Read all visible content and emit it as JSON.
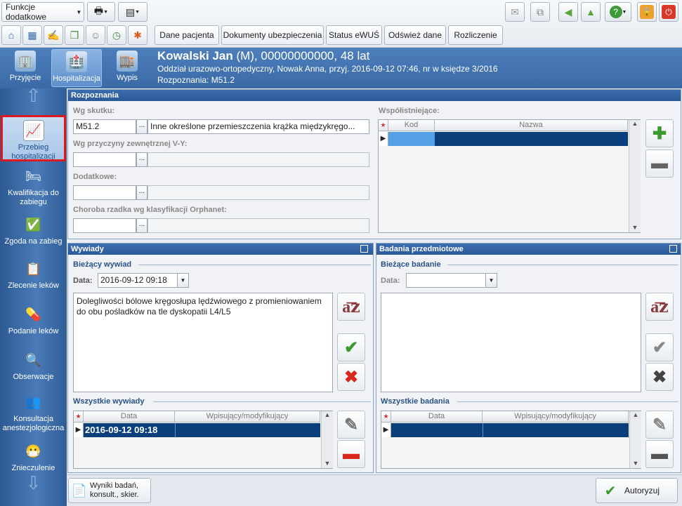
{
  "toolbar": {
    "funkcje_label": "Funkcje dodatkowe",
    "tabs": [
      "Dane pacjenta",
      "Dokumenty ubezpieczenia",
      "Status eWUŚ",
      "Odśwież dane",
      "Rozliczenie"
    ]
  },
  "nav": {
    "top": [
      {
        "label": "Przyjęcie"
      },
      {
        "label": "Hospitalizacja"
      },
      {
        "label": "Wypis"
      }
    ],
    "side": [
      {
        "label": "Przebieg hospitalizacji"
      },
      {
        "label": "Kwalifikacja do zabiegu"
      },
      {
        "label": "Zgoda na zabieg"
      },
      {
        "label": "Zlecenie leków"
      },
      {
        "label": "Podanie leków"
      },
      {
        "label": "Obserwacje"
      },
      {
        "label": "Konsultacja anestezjologiczna"
      },
      {
        "label": "Znieczulenie"
      }
    ]
  },
  "patient": {
    "name": "Kowalski Jan",
    "details": " (M), 00000000000, 48 lat",
    "line2": "Oddział urazowo-ortopedyczny, Nowak Anna, przyj. 2016-09-12 07:46, nr w księdze 3/2016",
    "line3": "Rozpoznania: M51.2"
  },
  "rozpoznania": {
    "title": "Rozpoznania",
    "wg_skutku_label": "Wg skutku:",
    "wg_skutku_code": "M51.2",
    "wg_skutku_name": "Inne określone przemieszczenia krążka międzykręgo...",
    "wg_przyczyny_label": "Wg przyczyny zewnętrznej V-Y:",
    "dodatkowe_label": "Dodatkowe:",
    "orphanet_label": "Choroba rzadka wg klasyfikacji Orphanet:",
    "wspol_label": "Współistniejące:",
    "wspol_cols": [
      "Kod",
      "Nazwa"
    ]
  },
  "wywiady": {
    "title": "Wywiady",
    "current_label": "Bieżący wywiad",
    "data_label": "Data:",
    "data_value": "2016-09-12 09:18",
    "text": "Dolegliwości bólowe kręgosłupa lędźwiowego z promieniowaniem do obu pośladków na tle dyskopatii L4/L5",
    "all_label": "Wszystkie wywiady",
    "cols": [
      "Data",
      "Wpisujący/modyfikujący"
    ],
    "rows": [
      {
        "date": "2016-09-12 09:18",
        "author": ""
      }
    ]
  },
  "badania": {
    "title": "Badania przedmiotowe",
    "current_label": "Bieżące badanie",
    "data_label": "Data:",
    "data_value": "",
    "all_label": "Wszystkie badania",
    "cols": [
      "Data",
      "Wpisujący/modyfikujący"
    ]
  },
  "bottom": {
    "wyniki_label": "Wyniki badań, konsult., skier.",
    "autoryzuj_label": "Autoryzuj"
  },
  "colors": {
    "accent": "#2f62a4",
    "selected": "#0a3f7c",
    "highlight": "#e0191e"
  }
}
